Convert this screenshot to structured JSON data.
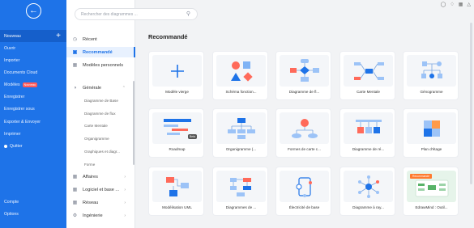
{
  "leftnav": {
    "items": [
      {
        "label": "Nouveau"
      },
      {
        "label": "Ouvrir"
      },
      {
        "label": "Importer"
      },
      {
        "label": "Documents Cloud"
      },
      {
        "label": "Modèles",
        "badge": "Nouveau"
      },
      {
        "label": "Enregistrer"
      },
      {
        "label": "Enregistrer sous"
      },
      {
        "label": "Exporter & Envoyer"
      },
      {
        "label": "Imprimer"
      },
      {
        "label": "Quitter"
      }
    ],
    "bottom": [
      {
        "label": "Compte"
      },
      {
        "label": "Options"
      }
    ]
  },
  "search": {
    "placeholder": "Rechercher des diagrammes ..."
  },
  "categories": {
    "top": [
      {
        "label": "Récent",
        "icon": "clock-icon"
      },
      {
        "label": "Recommandé",
        "icon": "star-icon"
      },
      {
        "label": "Modèles personnels",
        "icon": "user-templates-icon"
      }
    ],
    "general": {
      "label": "Générale"
    },
    "general_subs": [
      "Diagramme de Base",
      "Diagramme de flux",
      "Carte Mentale",
      "Organigramme",
      "Graphiques et diagr...",
      "Forme"
    ],
    "more": [
      {
        "label": "Affaires"
      },
      {
        "label": "Logiciel et base ..."
      },
      {
        "label": "Réseau"
      },
      {
        "label": "Ingénierie"
      }
    ]
  },
  "main": {
    "title": "Recommandé",
    "cards": [
      {
        "label": "Modèle vierge",
        "icon": "plus-icon"
      },
      {
        "label": "Schéma fonction...",
        "icon": "shapes-icon"
      },
      {
        "label": "Diagramme de fl...",
        "icon": "flowchart-icon"
      },
      {
        "label": "Carte Mentale",
        "icon": "mindmap-icon"
      },
      {
        "label": "Génogramme",
        "icon": "genogram-icon"
      },
      {
        "label": "Roadmap",
        "icon": "roadmap-icon",
        "badge": "Beta"
      },
      {
        "label": "Organigramme (...",
        "icon": "orgchart-icon"
      },
      {
        "label": "Formes de carte c...",
        "icon": "concept-map-icon"
      },
      {
        "label": "Diagramme de ré...",
        "icon": "network-icon"
      },
      {
        "label": "Plan d'étage",
        "icon": "floorplan-icon"
      },
      {
        "label": "Modélisation UML",
        "icon": "uml-icon"
      },
      {
        "label": "Diagrammes de ...",
        "icon": "diagram-icon"
      },
      {
        "label": "Électricité de base",
        "icon": "circuit-icon"
      },
      {
        "label": "Diagramme à ray...",
        "icon": "radial-icon"
      },
      {
        "label": "EdrawMind : Outil...",
        "icon": "edrawmind-icon",
        "badge": "Recommandé"
      }
    ]
  },
  "colors": {
    "primary": "#1e73e8",
    "active_nav": "#155fcb",
    "accent_orange": "#ff7a2e"
  }
}
